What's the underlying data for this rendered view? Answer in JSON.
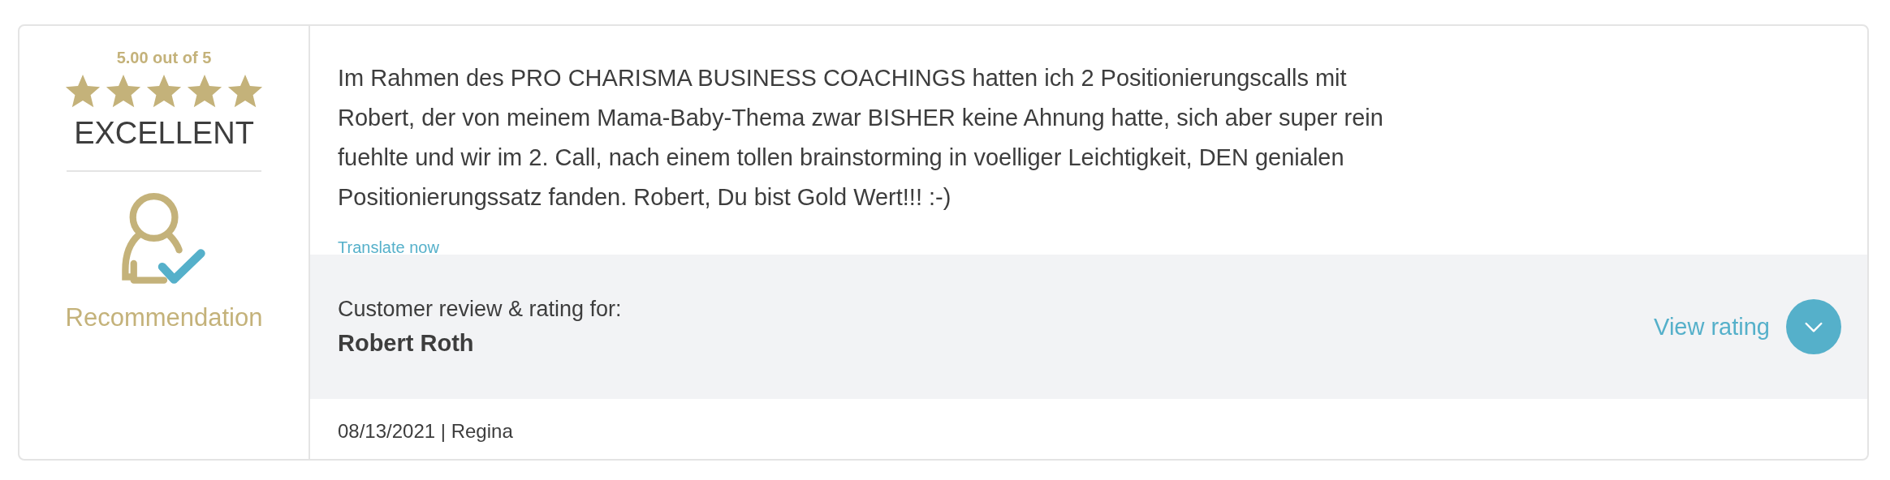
{
  "rating": {
    "score": "5.00 out of 5",
    "stars": 5,
    "verdict": "EXCELLENT",
    "badge_label": "Recommendation"
  },
  "review": {
    "text": "Im Rahmen des PRO CHARISMA BUSINESS COACHINGS hatten ich 2 Positionierungscalls mit Robert, der von meinem Mama-Baby-Thema zwar BISHER keine Ahnung hatte, sich aber super rein fuehlte und wir im 2. Call, nach einem tollen brainstorming in voelliger Leichtigkeit, DEN genialen Positionierungssatz fanden. Robert, Du bist Gold Wert!!! :-)",
    "translate_link": "Translate now"
  },
  "subject": {
    "caption": "Customer review & rating for:",
    "name": "Robert Roth",
    "view_link": "View rating",
    "expanded": false
  },
  "footer": {
    "meta": "08/13/2021 | Regina"
  }
}
